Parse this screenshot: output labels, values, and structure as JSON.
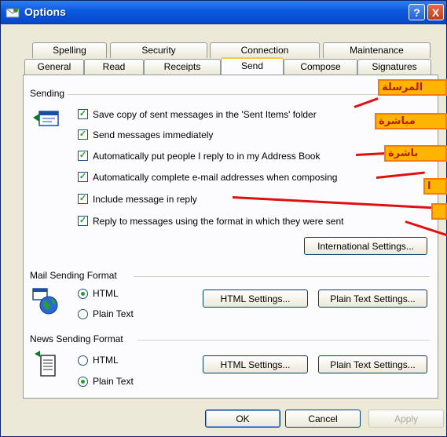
{
  "window": {
    "title": "Options"
  },
  "titlebar_buttons": {
    "help": "?",
    "close": "X"
  },
  "tabs_row1": [
    "Spelling",
    "Security",
    "Connection",
    "Maintenance"
  ],
  "tabs_row2": [
    "General",
    "Read",
    "Receipts",
    "Send",
    "Compose",
    "Signatures"
  ],
  "active_tab": "Send",
  "sending": {
    "label": "Sending",
    "options": [
      {
        "label": "Save copy of sent messages in the 'Sent Items' folder",
        "checked": true
      },
      {
        "label": "Send messages immediately",
        "checked": true
      },
      {
        "label": "Automatically put people I reply to in my Address Book",
        "checked": true
      },
      {
        "label": "Automatically complete e-mail addresses when composing",
        "checked": true
      },
      {
        "label": "Include message in reply",
        "checked": true
      },
      {
        "label": "Reply to messages using the format in which they were sent",
        "checked": true
      }
    ],
    "international_button": "International Settings..."
  },
  "mail_format": {
    "label": "Mail Sending Format",
    "html_option": "HTML",
    "plain_option": "Plain Text",
    "selected": "HTML",
    "html_settings_button": "HTML Settings...",
    "plain_settings_button": "Plain Text Settings..."
  },
  "news_format": {
    "label": "News Sending Format",
    "html_option": "HTML",
    "plain_option": "Plain Text",
    "selected": "Plain Text",
    "html_settings_button": "HTML Settings...",
    "plain_settings_button": "Plain Text Settings..."
  },
  "footer": {
    "ok": "OK",
    "cancel": "Cancel",
    "apply": "Apply"
  },
  "annotations": [
    "المرسلة",
    "مباشرة",
    "باشرة",
    "ا"
  ],
  "colors": {
    "title_bar": "#0a5ae0",
    "annotation_bg": "#ffb400",
    "arrow": "#e01010",
    "check": "#21a121"
  }
}
